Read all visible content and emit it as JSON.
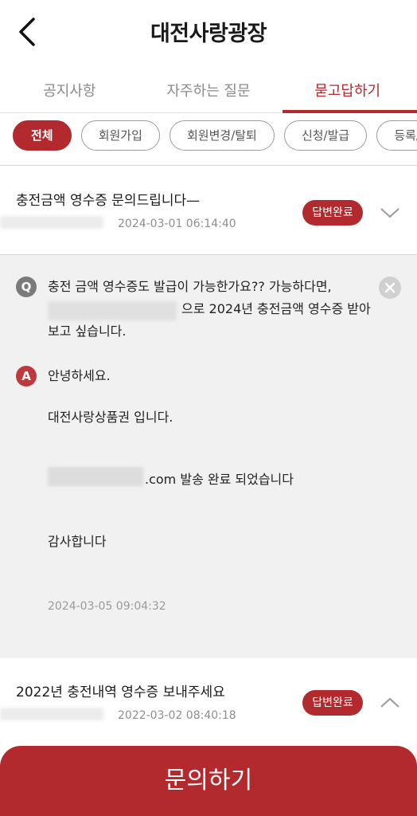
{
  "header": {
    "title": "대전사랑광장",
    "back_icon": "chevron-left-icon"
  },
  "tabs": [
    {
      "label": "공지사항",
      "active": false
    },
    {
      "label": "자주하는 질문",
      "active": false
    },
    {
      "label": "묻고답하기",
      "active": true
    }
  ],
  "chips": [
    {
      "label": "전체",
      "active": true
    },
    {
      "label": "회원가입"
    },
    {
      "label": "회원변경/탈퇴"
    },
    {
      "label": "신청/발급"
    },
    {
      "label": "등록/사용"
    }
  ],
  "questions": [
    {
      "title": "충전금액 영수증 문의드립니다—",
      "date": "2024-03-01 06:14:40",
      "status": "답변완료",
      "expanded": true,
      "question_line1": "충전 금액 영수증도 발급이 가능한가요?? 가능하다면,",
      "question_line2": "으로 2024년 충전금액 영수증 받아",
      "question_line3": "보고 싶습니다.",
      "answer_line1": "안녕하세요.",
      "answer_line2": "대전사랑상품권 입니다.",
      "answer_line3": ".com 발송 완료 되었습니다",
      "answer_line4": "감사합니다",
      "answer_date": "2024-03-05 09:04:32"
    },
    {
      "title": "2022년 충전내역 영수증 보내주세요",
      "date": "2022-03-02 08:40:18",
      "status": "답변완료",
      "expanded": false
    }
  ],
  "labels": {
    "q_mark": "Q",
    "a_mark": "A"
  },
  "cta": {
    "label": "문의하기"
  },
  "colors": {
    "accent": "#b2292e",
    "muted": "#8e8e8e",
    "panel_bg": "#f1f1f1"
  }
}
